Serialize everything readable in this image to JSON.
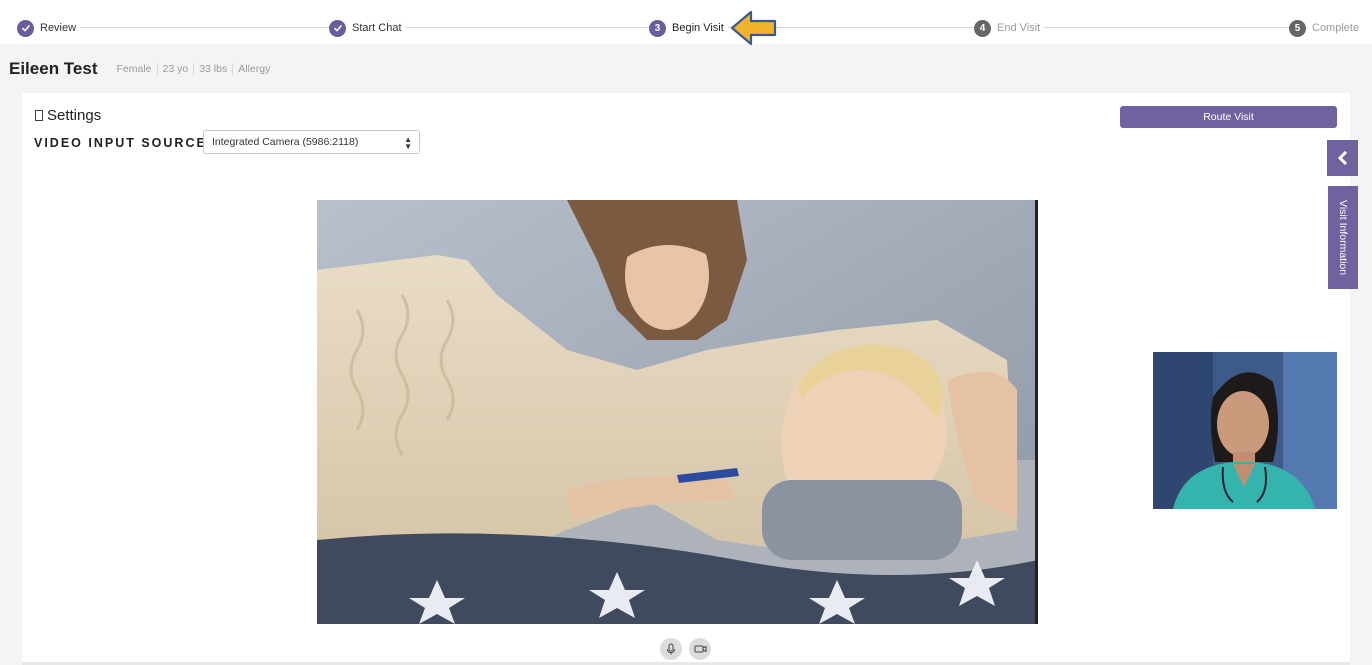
{
  "stepper": {
    "steps": [
      {
        "num": "✓",
        "label": "Review",
        "state": "done"
      },
      {
        "num": "✓",
        "label": "Start Chat",
        "state": "done"
      },
      {
        "num": "3",
        "label": "Begin Visit",
        "state": "active"
      },
      {
        "num": "4",
        "label": "End Visit",
        "state": "todo"
      },
      {
        "num": "5",
        "label": "Complete",
        "state": "todo"
      }
    ]
  },
  "patient": {
    "name": "Eileen Test",
    "gender": "Female",
    "age": "23 yo",
    "weight": "33 lbs",
    "allergy": "Allergy"
  },
  "settings": {
    "title": "Settings",
    "video_label": "VIDEO INPUT SOURCE",
    "video_source_value": "Integrated Camera (5986:2118)"
  },
  "actions": {
    "route_visit": "Route Visit"
  },
  "side": {
    "visit_info": "Visit Information"
  },
  "colors": {
    "accent": "#6b5d9c",
    "arrow": "#f2b32c"
  }
}
